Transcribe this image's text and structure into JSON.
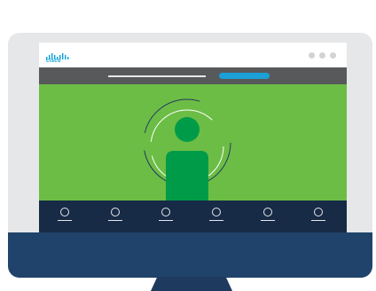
{
  "logo": {
    "text": "cisco"
  },
  "window_controls": [
    "dot",
    "dot",
    "dot"
  ],
  "toolbar": {
    "buttons": [
      {
        "name": "toolbar-button-1",
        "icon": "circle-icon"
      },
      {
        "name": "toolbar-button-2",
        "icon": "circle-icon"
      },
      {
        "name": "toolbar-button-3",
        "icon": "circle-icon"
      },
      {
        "name": "toolbar-button-4",
        "icon": "circle-icon"
      },
      {
        "name": "toolbar-button-5",
        "icon": "circle-icon"
      },
      {
        "name": "toolbar-button-6",
        "icon": "circle-icon"
      }
    ]
  },
  "colors": {
    "bezel": "#e6e7e8",
    "chin": "#20436c",
    "navbar": "#58595b",
    "accent": "#1ba0d7",
    "video_bg": "#6cbd45",
    "person": "#009b48",
    "toolbar": "#172b47"
  }
}
